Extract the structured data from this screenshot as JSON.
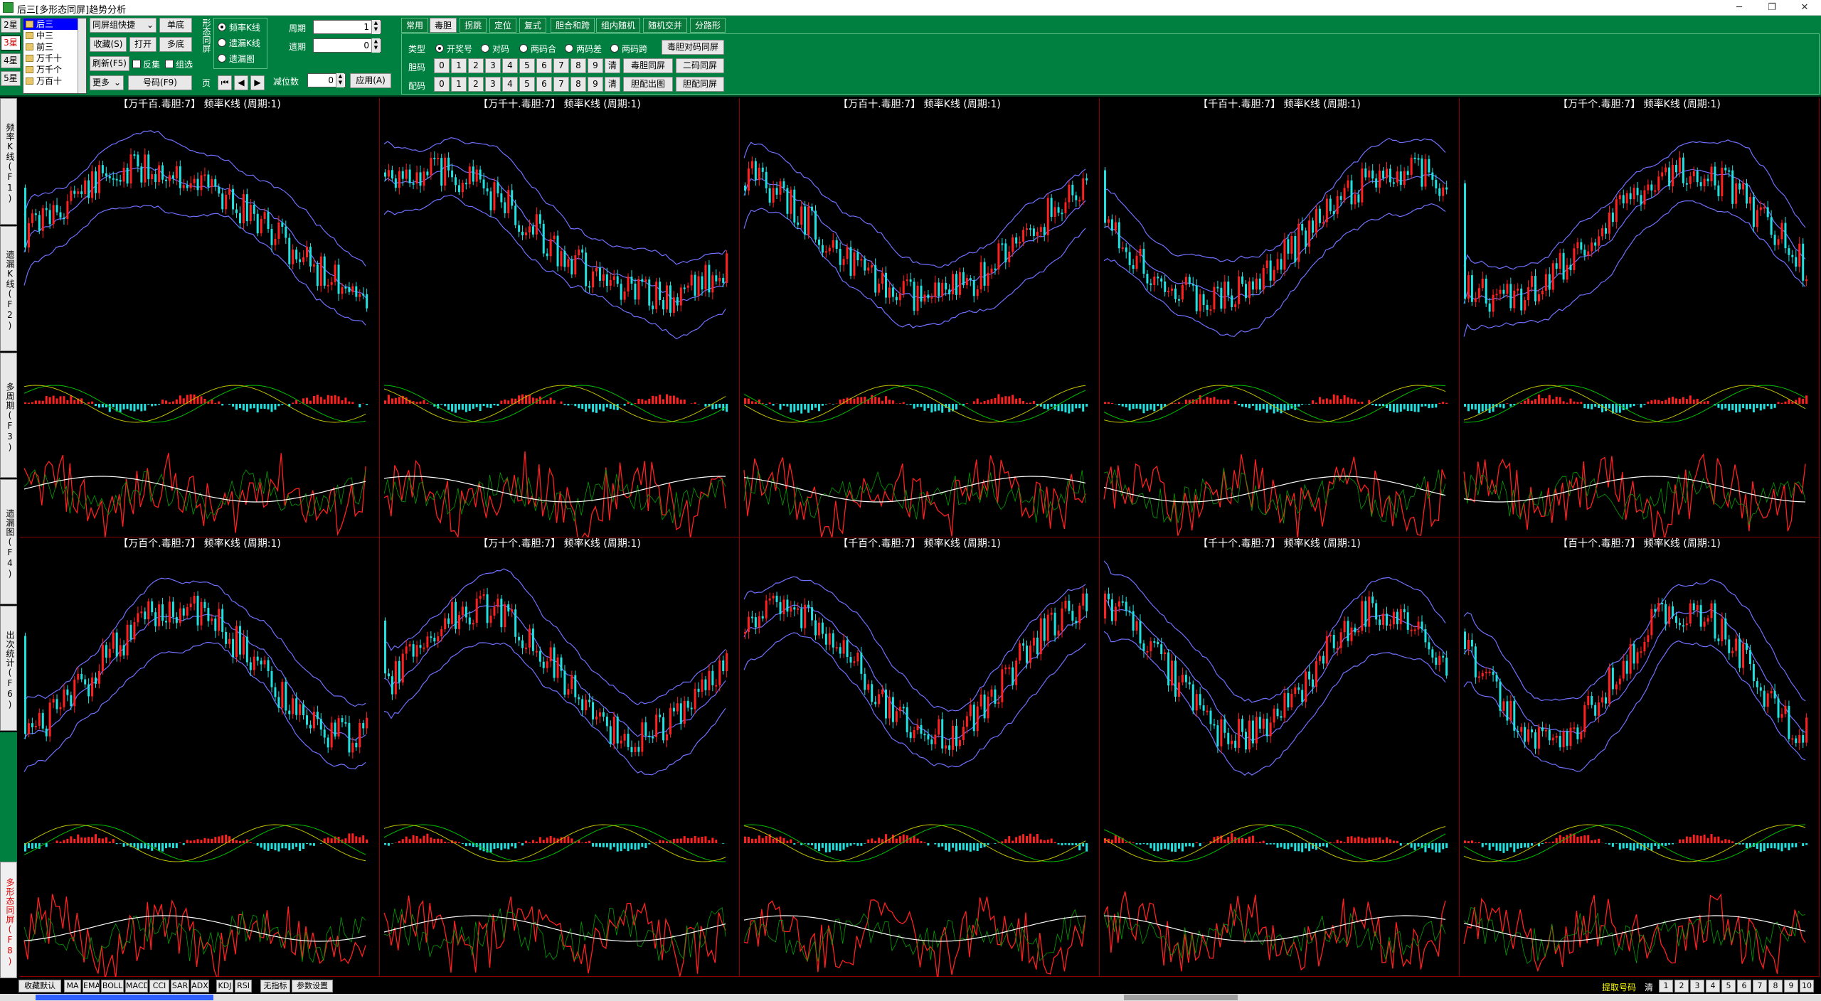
{
  "window": {
    "title": "后三[多形态同屏]趋势分析",
    "minimize": "─",
    "restore": "❐",
    "close": "✕"
  },
  "toolbar": {
    "stars": [
      "2星",
      "3星",
      "4星",
      "5星"
    ],
    "active_star": 1,
    "positions": [
      "后三",
      "中三",
      "前三",
      "万千十",
      "万千个",
      "万百十"
    ],
    "selected_position": 0,
    "combo_quick": "同屏组快捷",
    "btn_single": "单底",
    "btn_collect": "收藏(S)",
    "btn_open": "打开",
    "btn_multi": "多底",
    "btn_refresh": "刷新(F5)",
    "chk_reverse": "反集",
    "chk_group": "组选",
    "combo_more": "更多",
    "btn_code": "号码(F9)",
    "vertical_label": "形态同屏",
    "radio_freq": "频率K线",
    "radio_miss": "遗漏K线",
    "radio_misschart": "遗漏图",
    "page_label": "页",
    "cycle_label": "周期",
    "cycle_value": "1",
    "miss_label": "遗期",
    "miss_value": "0",
    "restrict_label": "减位数",
    "restrict_value": "0",
    "btn_apply": "应用(A)",
    "tabs": [
      "常用",
      "毒胆",
      "拐跳",
      "定位",
      "复式",
      "胆合和跨",
      "组内随机",
      "随机交并",
      "分路形"
    ],
    "active_tab": 1,
    "type_label": "类型",
    "type_options": [
      "开奖号",
      "对码",
      "两码合",
      "两码差",
      "两码跨"
    ],
    "type_selected": 0,
    "btn_pair_screen": "毒胆对码同屏",
    "dan_label": "胆码",
    "pei_label": "配码",
    "digits": [
      "0",
      "1",
      "2",
      "3",
      "4",
      "5",
      "6",
      "7",
      "8",
      "9"
    ],
    "clear_label": "清",
    "btn_dudan_screen": "毒胆同屏",
    "btn_erma_screen": "二码同屏",
    "btn_danpei_out": "胆配出图",
    "btn_danpei_screen": "胆配同屏"
  },
  "side_tabs": [
    "频率K线(F1)",
    "遗漏K线(F2)",
    "多周期(F3)",
    "遗漏图(F4)",
    "出次统计(F6)",
    "多形态同屏(F8)"
  ],
  "panels": [
    {
      "title": "【万千百.毒胆:7】 频率K线 (周期:1)"
    },
    {
      "title": "【万千十.毒胆:7】 频率K线 (周期:1)"
    },
    {
      "title": "【万百十.毒胆:7】 频率K线 (周期:1)"
    },
    {
      "title": "【千百十.毒胆:7】 频率K线 (周期:1)"
    },
    {
      "title": "【万千个.毒胆:7】 频率K线 (周期:1)"
    },
    {
      "title": "【万百个.毒胆:7】 频率K线 (周期:1)"
    },
    {
      "title": "【万十个.毒胆:7】 频率K线 (周期:1)"
    },
    {
      "title": "【千百个.毒胆:7】 频率K线 (周期:1)"
    },
    {
      "title": "【千十个.毒胆:7】 频率K线 (周期:1)"
    },
    {
      "title": "【百十个.毒胆:7】 频率K线 (周期:1)"
    }
  ],
  "status": {
    "buttons": [
      "收藏默认",
      "MA",
      "EMA",
      "BOLL",
      "MACD",
      "CCI",
      "SAR",
      "ADX",
      "KDJ",
      "RSI",
      "无指标",
      "参数设置"
    ],
    "extract_label": "提取号码",
    "clear_label": "清",
    "pages": [
      "1",
      "2",
      "3",
      "4",
      "5",
      "6",
      "7",
      "8",
      "9",
      "10"
    ]
  },
  "colors": {
    "up": "#ff2020",
    "down": "#20e0e0",
    "band": "#7070ff",
    "frame": "#8b0000",
    "toolbar": "#008040",
    "green": "#00a000"
  }
}
